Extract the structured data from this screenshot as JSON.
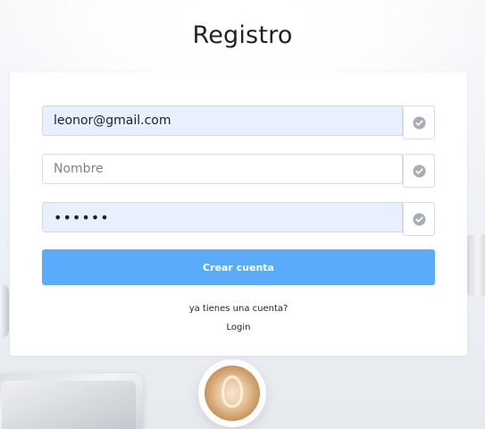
{
  "page": {
    "title": "Registro"
  },
  "form": {
    "email": {
      "value": "leonor@gmail.com",
      "placeholder": ""
    },
    "name": {
      "value": "",
      "placeholder": "Nombre"
    },
    "password": {
      "value": "••••••",
      "placeholder": ""
    },
    "addon_icon": "check-circle-icon",
    "submit_label": "Crear cuenta"
  },
  "footer": {
    "prompt": "ya tienes una cuenta?",
    "login_label": "Login"
  },
  "colors": {
    "accent": "#5aabfb",
    "autofill_bg": "#e8f0fe",
    "check_icon": "#a9aeb4"
  }
}
